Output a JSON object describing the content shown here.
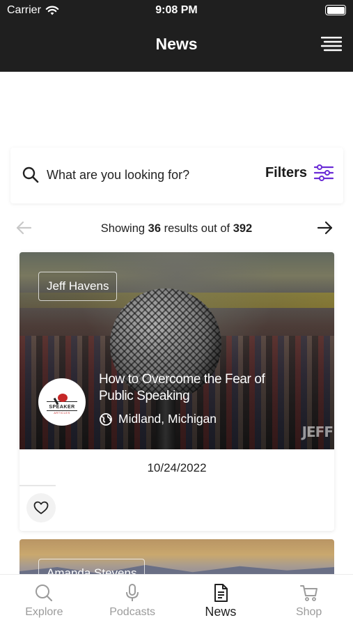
{
  "status_bar": {
    "carrier": "Carrier",
    "time": "9:08 PM"
  },
  "header": {
    "title": "News",
    "menu_icon": "hamburger-icon"
  },
  "search": {
    "placeholder": "What are you looking for?",
    "filters_label": "Filters",
    "accent_color": "#6a2cd6"
  },
  "pagination": {
    "prefix": "Showing",
    "shown": "36",
    "middle": "results out of",
    "total": "392"
  },
  "articles": [
    {
      "author": "Jeff Havens",
      "title": "How to Overcome the Fear of Public Speaking",
      "location": "Midland, Michigan",
      "date": "10/24/2022",
      "logo_text": "SPEAKER",
      "logo_subtext": "ARTICLES",
      "watermark": "JEFF"
    },
    {
      "author": "Amanda Stevens"
    }
  ],
  "tabs": [
    {
      "label": "Explore",
      "icon": "search-icon",
      "active": false
    },
    {
      "label": "Podcasts",
      "icon": "microphone-icon",
      "active": false
    },
    {
      "label": "News",
      "icon": "document-icon",
      "active": true
    },
    {
      "label": "Shop",
      "icon": "cart-icon",
      "active": false
    }
  ]
}
